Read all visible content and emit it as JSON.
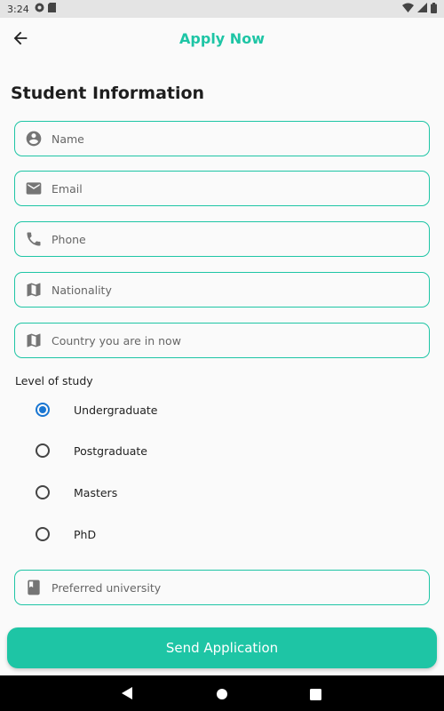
{
  "status_bar": {
    "time": "3:24"
  },
  "app_bar": {
    "title": "Apply Now"
  },
  "section": {
    "title": "Student Information"
  },
  "fields": {
    "name": {
      "placeholder": "Name",
      "icon": "person-icon"
    },
    "email": {
      "placeholder": "Email",
      "icon": "email-icon"
    },
    "phone": {
      "placeholder": "Phone",
      "icon": "phone-icon"
    },
    "nationality": {
      "placeholder": "Nationality",
      "icon": "map-icon"
    },
    "country": {
      "placeholder": "Country you are in now",
      "icon": "map-icon"
    },
    "university": {
      "placeholder": "Preferred university",
      "icon": "book-icon"
    }
  },
  "level": {
    "label": "Level of study",
    "options": [
      "Undergraduate",
      "Postgraduate",
      "Masters",
      "PhD"
    ],
    "selected": "Undergraduate"
  },
  "submit": {
    "label": "Send Application"
  },
  "colors": {
    "accent": "#1ec5a5",
    "radio_selected": "#1976d2"
  }
}
